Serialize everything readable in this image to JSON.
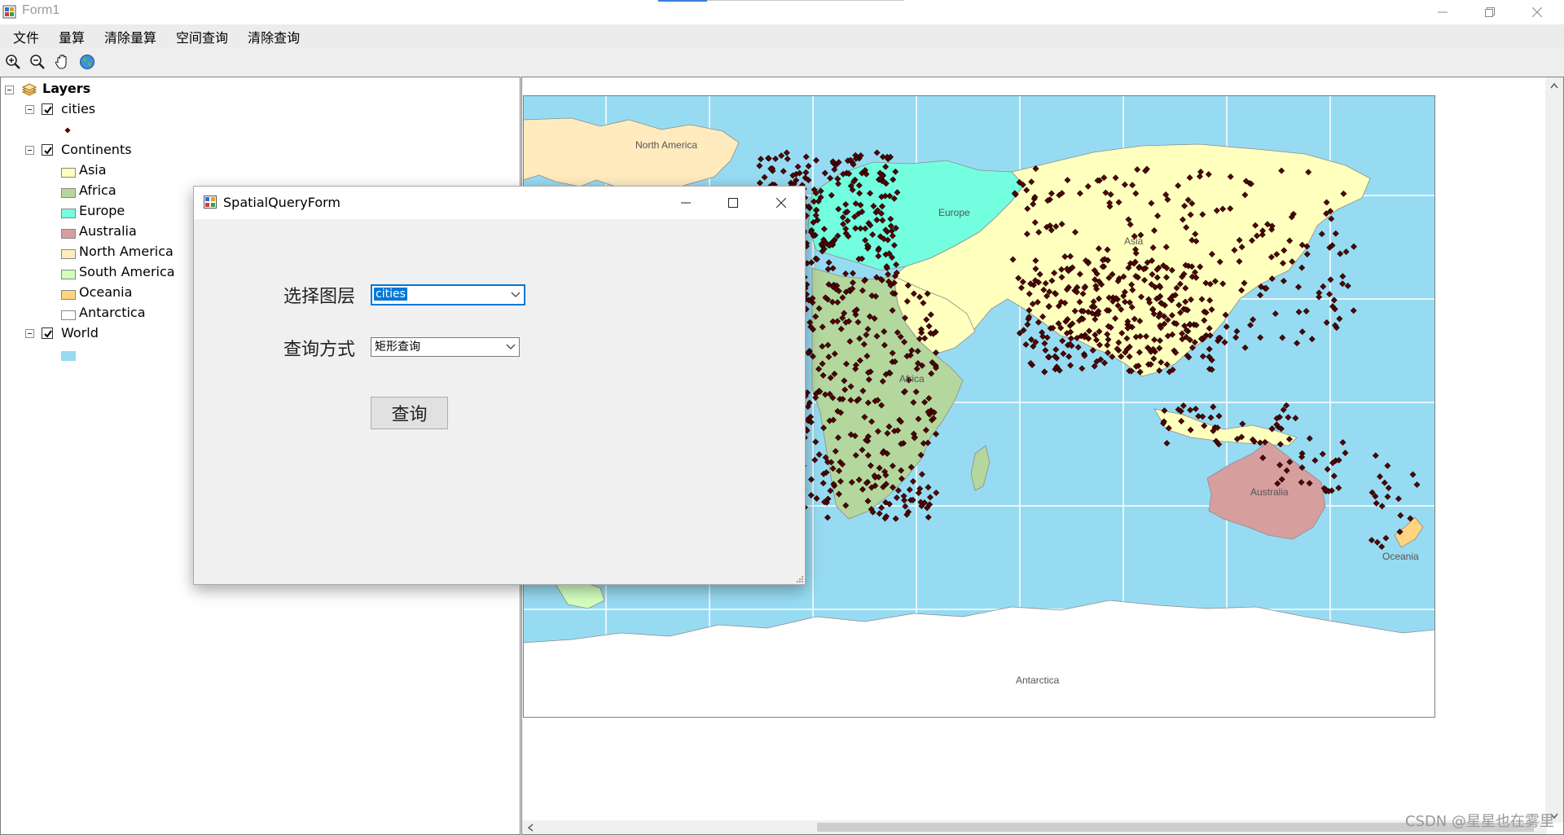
{
  "window": {
    "title": "Form1"
  },
  "menu": {
    "items": [
      "文件",
      "量算",
      "清除量算",
      "空间查询",
      "清除查询"
    ]
  },
  "toolbar": {
    "tools": [
      "zoom-in-icon",
      "zoom-out-icon",
      "pan-hand-icon",
      "full-extent-globe-icon"
    ]
  },
  "toc": {
    "root_label": "Layers",
    "layers": [
      {
        "name": "cities",
        "checked": true,
        "symbol": "diamond",
        "symbol_color": "#5a0000"
      },
      {
        "name": "Continents",
        "checked": true,
        "classes": [
          {
            "label": "Asia",
            "color": "#ffffbe"
          },
          {
            "label": "Africa",
            "color": "#b4d79e"
          },
          {
            "label": "Europe",
            "color": "#73ffdf"
          },
          {
            "label": "Australia",
            "color": "#d79e9e"
          },
          {
            "label": "North America",
            "color": "#ffebbe"
          },
          {
            "label": "South America",
            "color": "#d3ffbe"
          },
          {
            "label": "Oceania",
            "color": "#ffd37f"
          },
          {
            "label": "Antarctica",
            "color": "#ffffff"
          }
        ]
      },
      {
        "name": "World",
        "checked": true,
        "fill": "#97dbf2"
      }
    ]
  },
  "map": {
    "labels": [
      "North America",
      "Europe",
      "Asia",
      "Africa",
      "Australia",
      "Oceania",
      "Antarctica"
    ],
    "ocean_color": "#97dbf2",
    "city_color": "#5a0000"
  },
  "dialog": {
    "title": "SpatialQueryForm",
    "layer_label": "选择图层",
    "layer_value": "cities",
    "method_label": "查询方式",
    "method_value": "矩形查询",
    "query_button": "查询"
  },
  "watermark": "CSDN @星星也在雾里"
}
